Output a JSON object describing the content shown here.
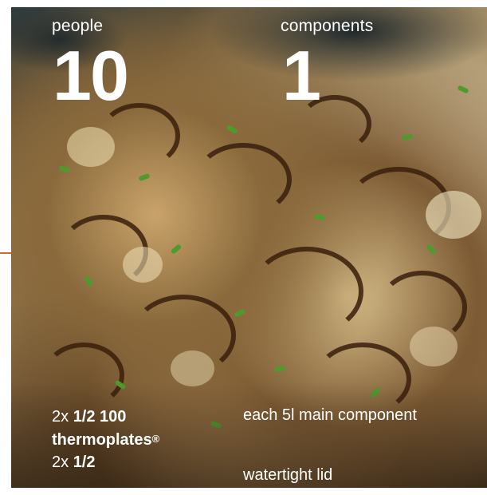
{
  "stats": [
    {
      "label": "people",
      "value": "10"
    },
    {
      "label": "components",
      "value": "1"
    }
  ],
  "specs": {
    "line1_qty": "2x",
    "line1_size": "1/2 100",
    "line2_name": "thermoplates",
    "line2_reg": "®",
    "line3_qty": "2x",
    "line3_size": "1/2",
    "right_line1": "each 5l main component",
    "right_line2": "watertight lid"
  },
  "colors": {
    "accent": "#e3621f",
    "text": "#ffffff"
  }
}
